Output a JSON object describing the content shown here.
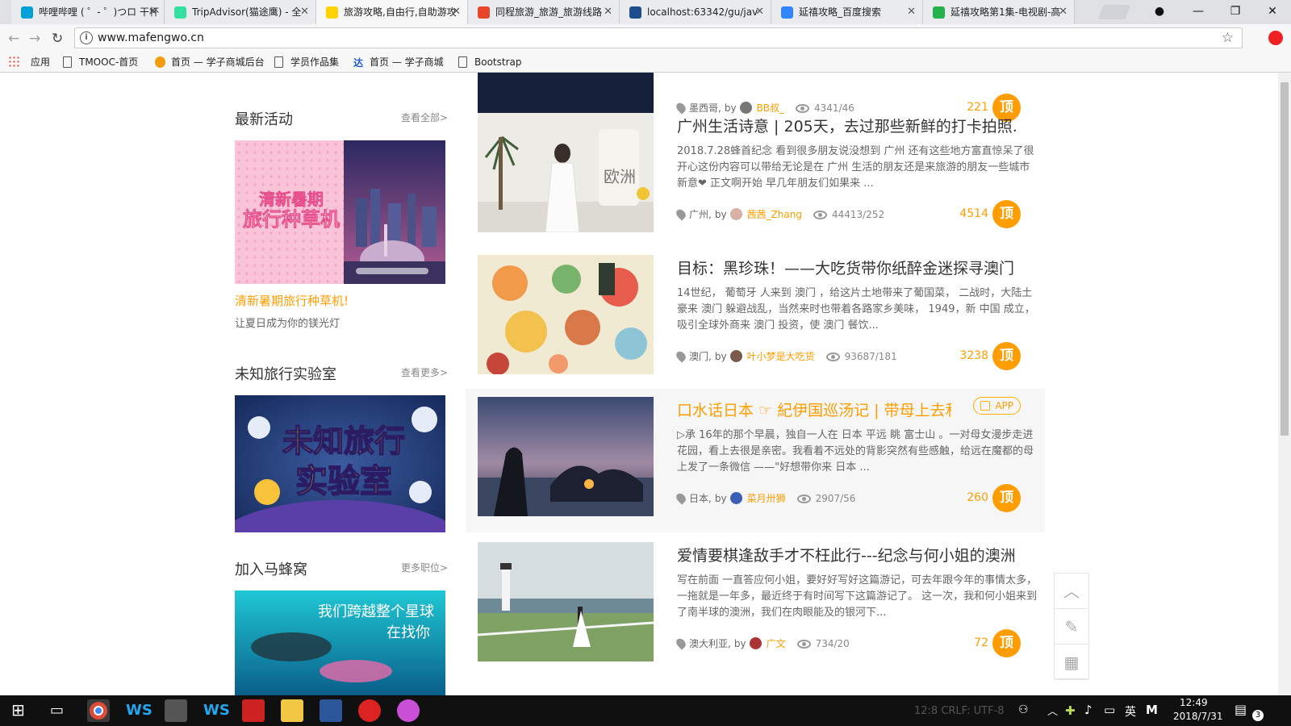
{
  "browser": {
    "tabs": [
      {
        "title": "哔哩哔哩 ( ゜- ゜)つロ 干杯",
        "color": "#00a1d6"
      },
      {
        "title": "TripAdvisor(猫途鹰) - 全",
        "color": "#34e0a1"
      },
      {
        "title": "旅游攻略,自由行,自助游攻",
        "color": "#ffd200"
      },
      {
        "title": "同程旅游_旅游_旅游线路",
        "color": "#e8462a"
      },
      {
        "title": "localhost:63342/gu/jav",
        "color": "#1b4e8a"
      },
      {
        "title": "延禧攻略_百度搜索",
        "color": "#3385ff"
      },
      {
        "title": "延禧攻略第1集-电视剧-高",
        "color": "#25b24a"
      }
    ],
    "url": "www.mafengwo.cn",
    "bookmarks": [
      "应用",
      "TMOOC-首页",
      "首页 — 学子商城后台",
      "学员作品集",
      "首页 — 学子商城",
      "Bootstrap"
    ]
  },
  "sidebar": {
    "activities": {
      "title": "最新活动",
      "more": "查看全部>",
      "caption": "清新暑期旅行种草机!",
      "sub": "让夏日成为你的镁光灯",
      "banner_text": "清新暑期 旅行种草机"
    },
    "lab": {
      "title": "未知旅行实验室",
      "more": "查看更多>",
      "banner_text": "未知旅行 实验室"
    },
    "join": {
      "title": "加入马蜂窝",
      "more": "更多职位>",
      "banner_text": "我们跨越整个星球 在找你"
    }
  },
  "feed": {
    "top_partial": {
      "place": "墨西哥",
      "by": "by",
      "author": "BB叔_",
      "views": "4341/46",
      "score": "221",
      "ding": "顶"
    },
    "items": [
      {
        "title": "广州生活诗意 | 205天，去过那些新鲜的打卡拍照...",
        "desc": "2018.7.28蜂首纪念 看到很多朋友说没想到 广州 还有这些地方富直惊呆了很开心这份内容可以带给无论是在 广州 生活的朋友还是来旅游的朋友一些城市新意❤ 正文啊开始 早几年朋友们如果来 ...",
        "place": "广州",
        "by": "by",
        "author": "茜茜_Zhang",
        "views": "44413/252",
        "score": "4514",
        "ding": "顶"
      },
      {
        "title": "目标：黑珍珠！——大吃货带你纸醉金迷探寻澳门...",
        "desc": "14世纪， 葡萄牙 人来到 澳门 ，给这片土地带来了葡国菜， 二战时，大陆土豪来 澳门 躲避战乱，当然来时也带着各路家乡美味， 1949，新 中国 成立，吸引全球外商来 澳门 投资，使 澳门 餐饮...",
        "place": "澳门",
        "by": "by",
        "author": "叶小梦是大吃货",
        "views": "93687/181",
        "score": "3238",
        "ding": "顶"
      },
      {
        "title": "口水话日本 ☞ 紀伊国巡汤记 | 带母上去和...",
        "badge": "APP",
        "desc": "▷承 16年的那个早晨，独自一人在 日本 平远 眺 富士山 。一对母女漫步走进花园，看上去很是亲密。我看着不远处的背影突然有些感触，给远在魔都的母上发了一条微信 ——\"好想带你来 日本 ...",
        "place": "日本",
        "by": "by",
        "author": "菜月卅狮",
        "views": "2907/56",
        "score": "260",
        "ding": "顶"
      },
      {
        "title": "爱情要棋逢敌手才不枉此行---纪念与何小姐的澳洲...",
        "desc": "写在前面 一直答应何小姐，要好好写好这篇游记，可去年跟今年的事情太多，一拖就是一年多，最近终于有时间写下这篇游记了。 这一次，我和何小姐来到了南半球的澳洲，我们在肉眼能及的银河下...",
        "place": "澳大利亚",
        "by": "by",
        "author": "广文",
        "views": "734/20",
        "score": "72",
        "ding": "顶"
      }
    ]
  },
  "floating": {
    "side_tab": "83"
  },
  "taskbar": {
    "ime": "英",
    "time": "12:49",
    "date": "2018/7/31",
    "notif_count": "3",
    "dim_text": "12:8  CRLF:  UTF-8"
  }
}
